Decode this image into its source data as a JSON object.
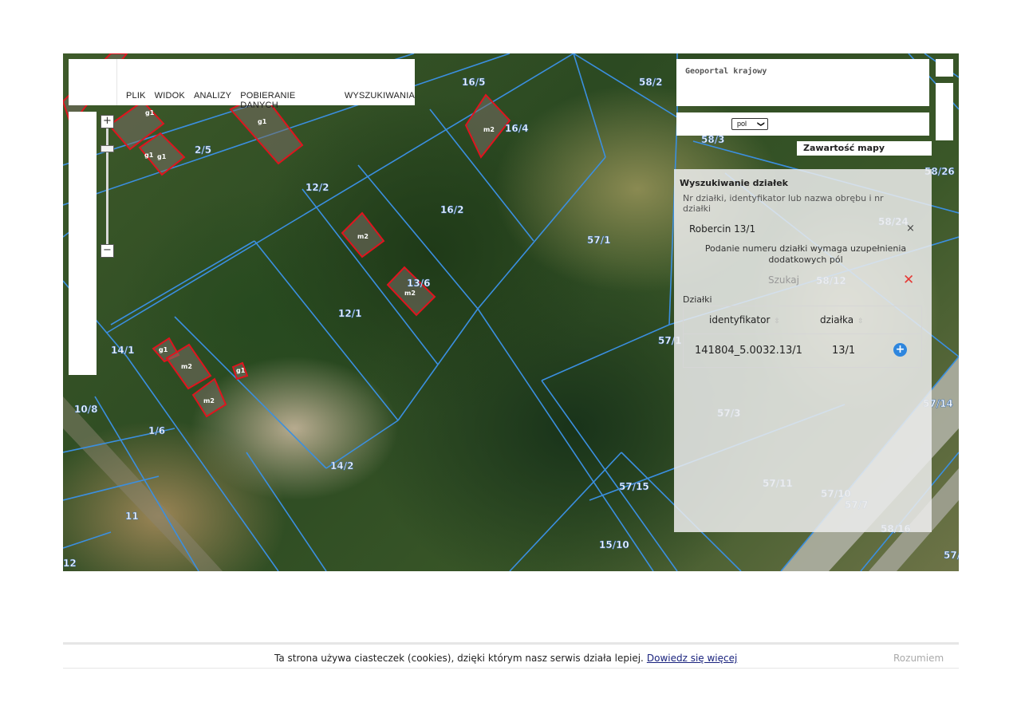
{
  "menu": {
    "items": [
      "PLIK",
      "WIDOK",
      "ANALIZY",
      "POBIERANIE DANYCH",
      "WYSZUKIWANIA"
    ]
  },
  "zoom": {
    "in_label": "+",
    "out_label": "−"
  },
  "geoportal": {
    "title": "Geoportal krajowy"
  },
  "language": {
    "selected": "pol",
    "chevron": "❯"
  },
  "map_contents_button": "Zawartość mapy",
  "search_panel": {
    "title": "Wyszukiwanie działek",
    "hint": "Nr działki, identyfikator lub nazwa obrębu i nr działki",
    "query": "Robercin 13/1",
    "clear_icon": "×",
    "warning": "Podanie numeru działki wymaga uzupełnienia dodatkowych pól",
    "search_label": "Szukaj",
    "close_icon": "✕",
    "results_label": "Działki",
    "columns": [
      "identyfikator",
      "działka"
    ],
    "sort_icon": "⇳",
    "rows": [
      {
        "identyfikator": "141804_5.0032.13/1",
        "dzialka": "13/1",
        "action_icon": "+"
      }
    ]
  },
  "map": {
    "parcel_labels": [
      "16/5",
      "58/2",
      "16/4",
      "2/5",
      "12/2",
      "16/2",
      "58/3",
      "58/26",
      "58/24",
      "57/1",
      "13/6",
      "12/1",
      "58/12",
      "14/1",
      "57/1",
      "10/8",
      "1/6",
      "57/3",
      "57/14",
      "14/2",
      "57/15",
      "57/11",
      "57/10",
      "57/7",
      "11",
      "15/10",
      "58/16",
      "12",
      "57/"
    ],
    "building_labels": [
      "g1",
      "g1",
      "g1",
      "m2",
      "m2",
      "m2",
      "m2",
      "g1",
      "m2",
      "g1",
      "g1"
    ],
    "boundary_color": "#3b8fe0",
    "building_color": "#e0141e"
  },
  "cookie": {
    "text": "Ta strona używa ciasteczek (cookies), dzięki którym nasz serwis działa lepiej.",
    "link": "Dowiedz się więcej",
    "accept": "Rozumiem"
  }
}
